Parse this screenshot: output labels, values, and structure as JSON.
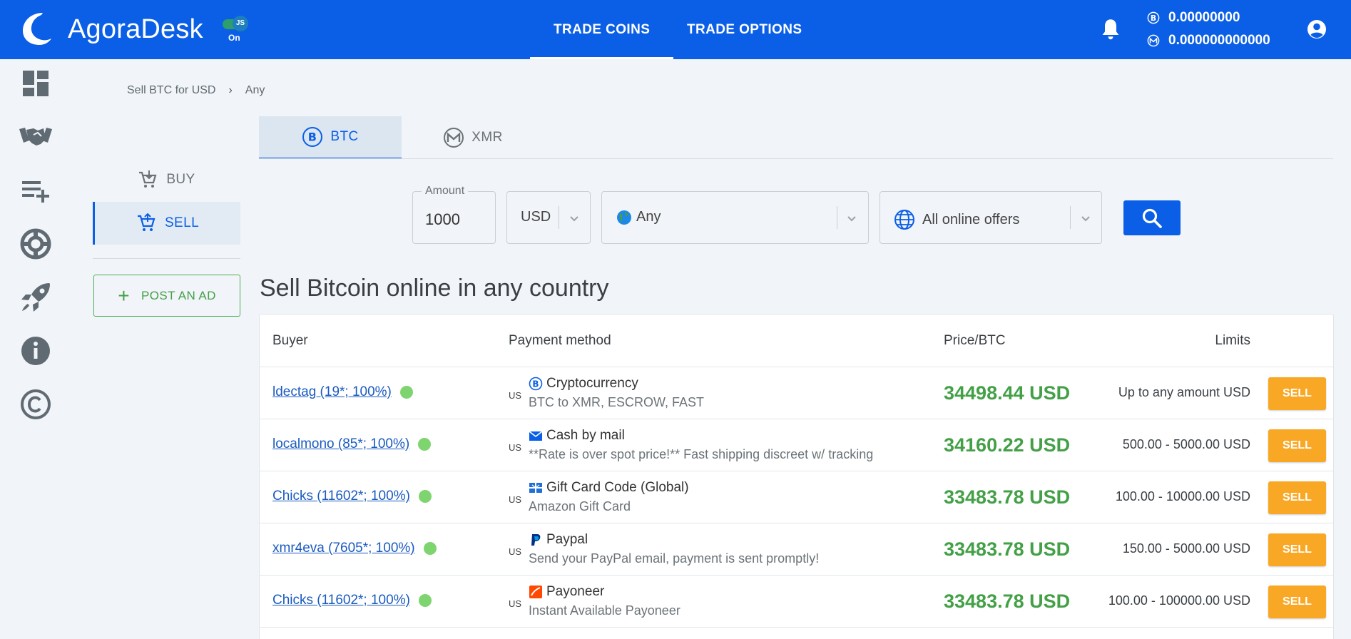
{
  "header": {
    "brand": "AgoraDesk",
    "js_toggle": {
      "badge": "JS",
      "state": "On"
    },
    "nav": [
      {
        "label": "TRADE COINS",
        "active": true
      },
      {
        "label": "TRADE OPTIONS",
        "active": false
      }
    ],
    "balances": [
      {
        "coin": "btc",
        "value": "0.00000000"
      },
      {
        "coin": "xmr",
        "value": "0.000000000000"
      }
    ]
  },
  "sidebar_icons": [
    "dashboard-icon",
    "handshake-icon",
    "playlist-add-icon",
    "lifebuoy-icon",
    "rocket-icon",
    "info-icon",
    "copyright-icon"
  ],
  "breadcrumb": {
    "first": "Sell BTC for USD",
    "separator": "›",
    "second": "Any"
  },
  "side_menu": {
    "buy": "BUY",
    "sell": "SELL",
    "post_ad": "POST AN AD",
    "post_ad_icon": "+"
  },
  "currency_tabs": [
    {
      "label": "BTC",
      "active": true
    },
    {
      "label": "XMR",
      "active": false
    }
  ],
  "filters": {
    "amount_label": "Amount",
    "amount_value": "1000",
    "currency": "USD",
    "country": "Any",
    "offer_type": "All online offers"
  },
  "title": "Sell Bitcoin online in any country",
  "table": {
    "headers": {
      "buyer": "Buyer",
      "payment": "Payment method",
      "price": "Price/BTC",
      "limits": "Limits"
    },
    "sell_label": "SELL",
    "rows": [
      {
        "buyer": "ldectag (19*; 100%)",
        "cc": "US",
        "pm_icon": "bitcoin-icon",
        "pm": "Cryptocurrency",
        "pm_sub": "BTC to XMR, ESCROW, FAST",
        "price": "34498.44 USD",
        "limits": "Up to any amount USD"
      },
      {
        "buyer": "localmono (85*; 100%)",
        "cc": "US",
        "pm_icon": "mail-icon",
        "pm": "Cash by mail",
        "pm_sub": "**Rate is over spot price!** Fast shipping discreet w/ tracking",
        "price": "34160.22 USD",
        "limits": "500.00 - 5000.00 USD"
      },
      {
        "buyer": "Chicks (11602*; 100%)",
        "cc": "US",
        "pm_icon": "gift-card-icon",
        "pm": "Gift Card Code (Global)",
        "pm_sub": "Amazon Gift Card",
        "price": "33483.78 USD",
        "limits": "100.00 - 10000.00 USD"
      },
      {
        "buyer": "xmr4eva (7605*; 100%)",
        "cc": "US",
        "pm_icon": "paypal-icon",
        "pm": "Paypal",
        "pm_sub": "Send your PayPal email, payment is sent promptly!",
        "price": "33483.78 USD",
        "limits": "150.00 - 5000.00 USD"
      },
      {
        "buyer": "Chicks (11602*; 100%)",
        "cc": "US",
        "pm_icon": "payoneer-icon",
        "pm": "Payoneer",
        "pm_sub": "Instant Available Payoneer",
        "price": "33483.78 USD",
        "limits": "100.00 - 100000.00 USD"
      }
    ]
  },
  "colors": {
    "header": "#0b5fe6",
    "price": "#43a047",
    "sell_button": "#f9a825",
    "online": "#7ed56f"
  }
}
